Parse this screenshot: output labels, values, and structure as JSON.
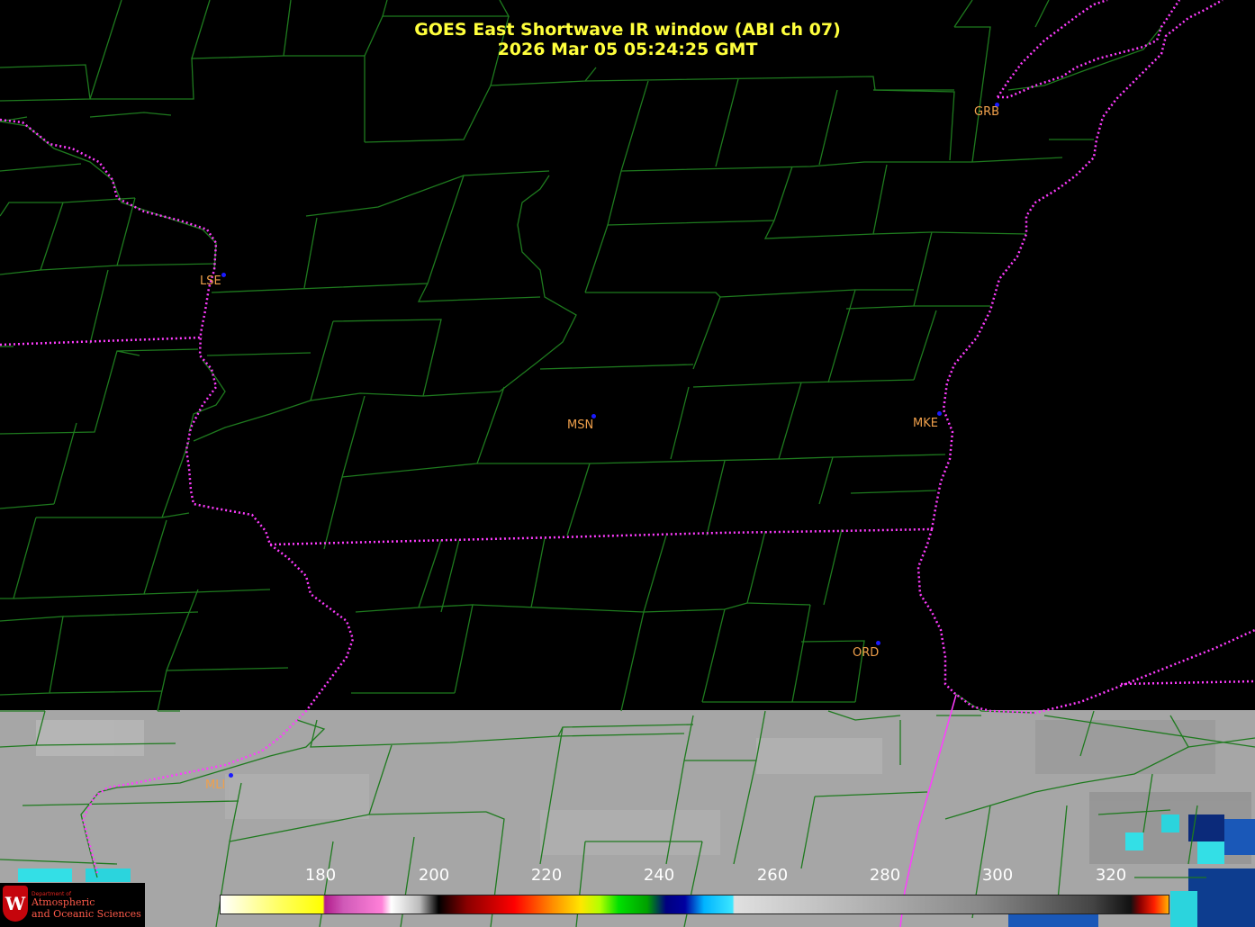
{
  "title_line1": "GOES East Shortwave IR window (ABI ch 07)",
  "title_line2": "2026 Mar 05  05:24:25 GMT",
  "stations": [
    {
      "id": "GRB"
    },
    {
      "id": "LSE"
    },
    {
      "id": "MSN"
    },
    {
      "id": "MKE"
    },
    {
      "id": "ORD"
    },
    {
      "id": "MLI"
    }
  ],
  "colorbar": {
    "ticks": [
      "180",
      "200",
      "220",
      "240",
      "260",
      "280",
      "300",
      "320"
    ]
  },
  "logo": {
    "crest_letter": "W",
    "dept": "Department of",
    "line1": "Atmospheric",
    "line2": "and Oceanic Sciences"
  },
  "colors": {
    "county_lines": "#1e7a1e",
    "state_lines": "#ff3cff",
    "title": "#ffff3c",
    "station_label": "#f0a04b",
    "station_dot": "#1a1aff",
    "cloud_gray": "#a8a8a8"
  }
}
